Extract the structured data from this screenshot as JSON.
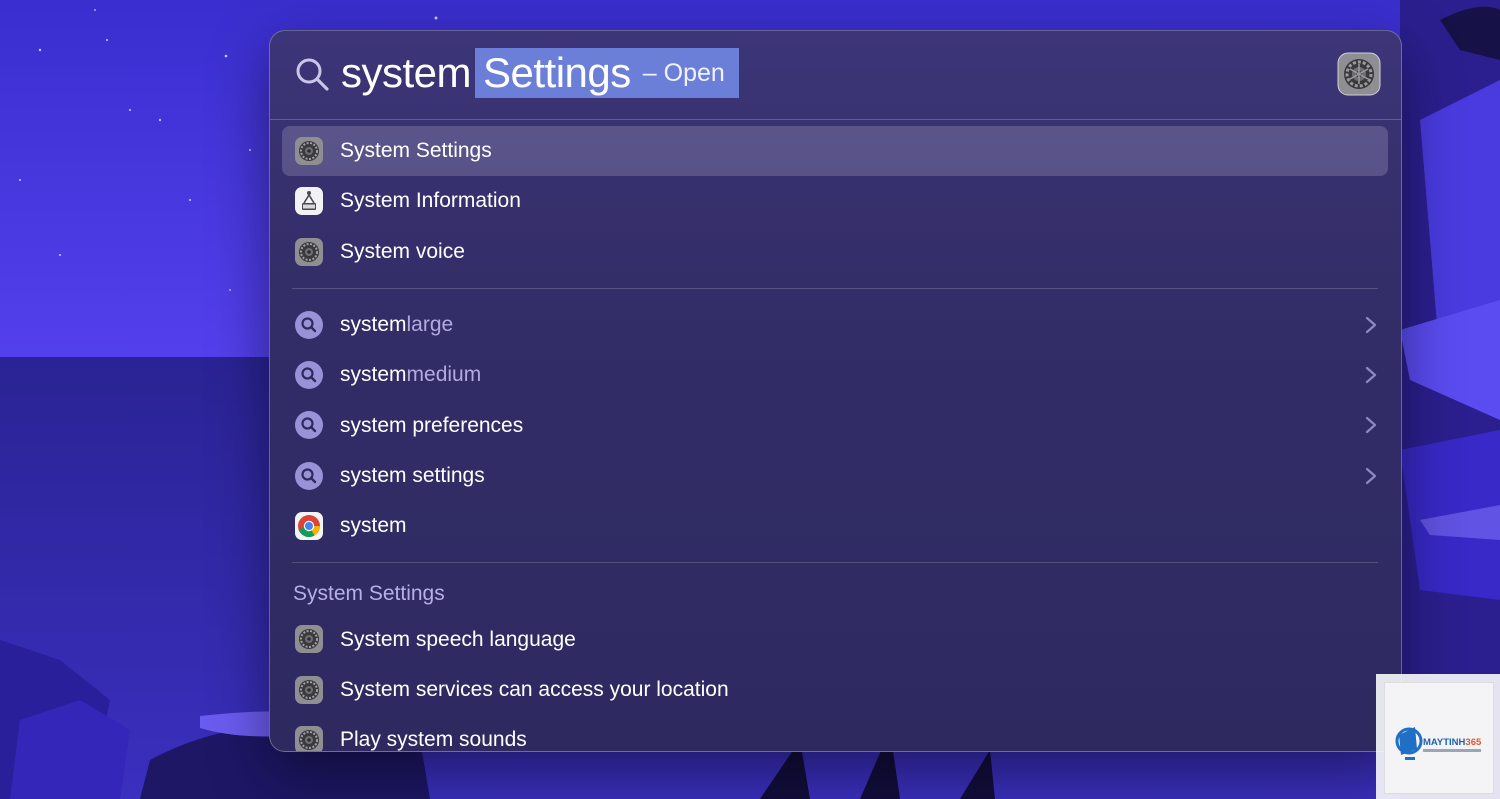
{
  "spotlight": {
    "query_typed": "system",
    "query_completion": "Settings",
    "query_action": "– Open",
    "top_app_icon": "system-settings-icon",
    "results": [
      {
        "label": "System Settings",
        "icon": "system-settings-icon",
        "selected": true
      },
      {
        "label": "System Information",
        "icon": "system-information-icon"
      },
      {
        "label": "System voice",
        "icon": "system-settings-icon"
      }
    ],
    "suggestions": [
      {
        "bold": "system",
        "dim": "large",
        "icon": "search-icon",
        "chevron": true
      },
      {
        "bold": "system",
        "dim": "medium",
        "icon": "search-icon",
        "chevron": true
      },
      {
        "bold": "system preferences",
        "dim": "",
        "icon": "search-icon",
        "chevron": true
      },
      {
        "bold": "system settings",
        "dim": "",
        "icon": "search-icon",
        "chevron": true
      },
      {
        "bold": "system",
        "dim": "",
        "icon": "chrome-icon",
        "chevron": false
      }
    ],
    "section_title": "System Settings",
    "section_items": [
      {
        "label": "System speech language",
        "icon": "system-settings-icon"
      },
      {
        "label": "System services can access your location",
        "icon": "system-settings-icon"
      },
      {
        "label": "Play system sounds",
        "icon": "system-settings-icon"
      }
    ]
  },
  "watermark": {
    "brand": "MAYTINH365",
    "tagline": "Chia sẻ & Thủ thuật Máy tính"
  },
  "colors": {
    "selection": "#6b7fd9",
    "panel": "#342e6a",
    "wallpaper": "#3b2fc9"
  }
}
